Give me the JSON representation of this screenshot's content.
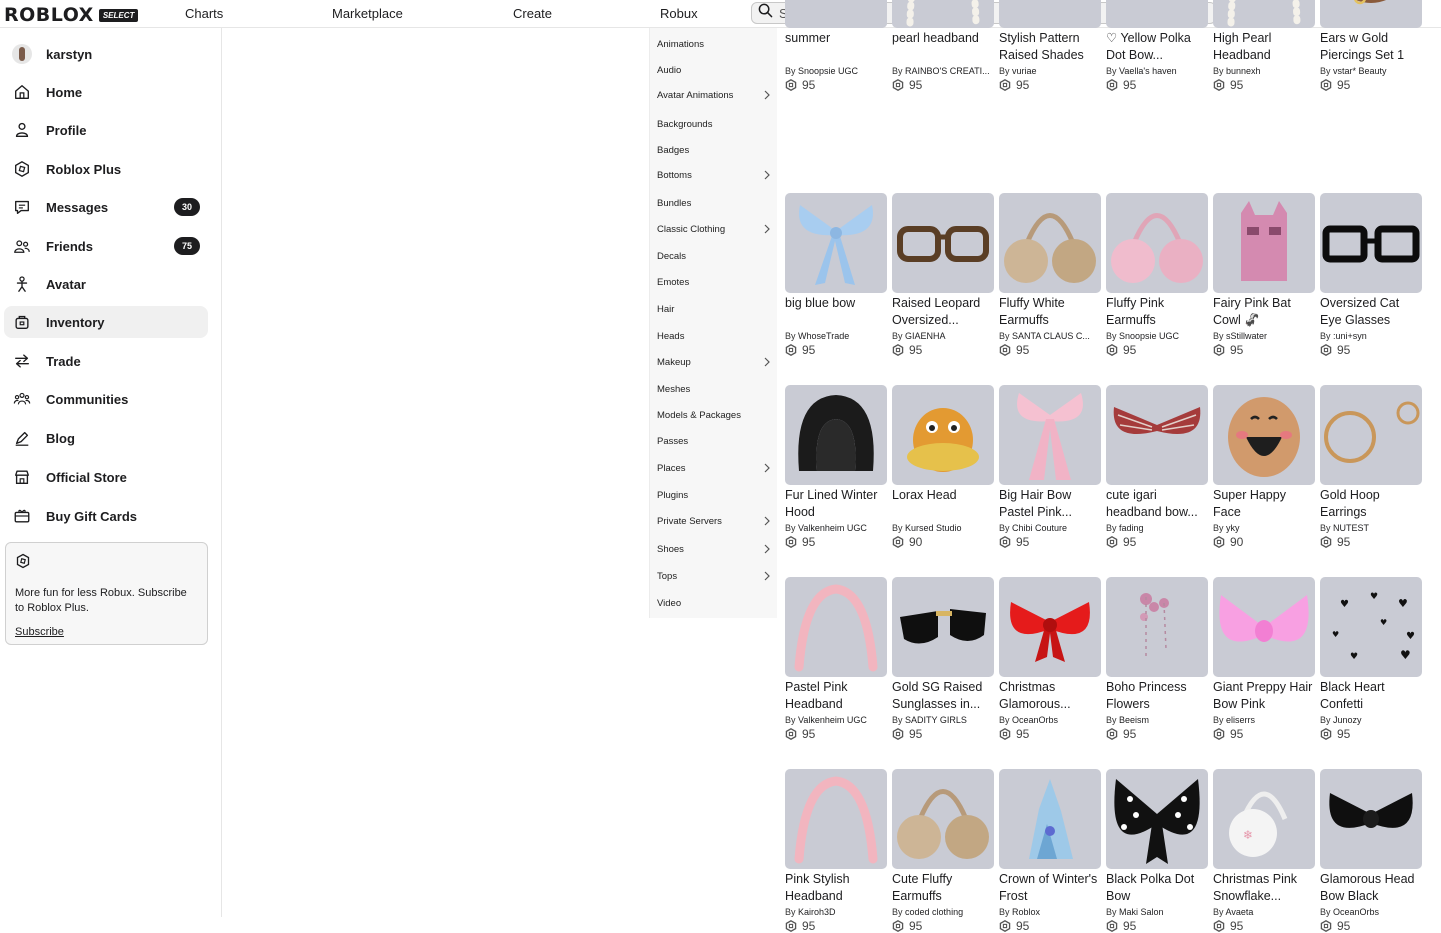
{
  "topbar": {
    "logo": "ROBLOX",
    "logo_badge": "SELECT",
    "nav": [
      "Charts",
      "Marketplace",
      "Create",
      "Robux"
    ],
    "search_placeholder": "Search"
  },
  "sidebar": {
    "user": "karstyn",
    "items": [
      {
        "label": "Home",
        "icon": "home-icon"
      },
      {
        "label": "Profile",
        "icon": "profile-icon"
      },
      {
        "label": "Roblox Plus",
        "icon": "roblox-plus-icon"
      },
      {
        "label": "Messages",
        "icon": "messages-icon",
        "count": "30"
      },
      {
        "label": "Friends",
        "icon": "friends-icon",
        "count": "75"
      },
      {
        "label": "Avatar",
        "icon": "avatar-icon"
      },
      {
        "label": "Inventory",
        "icon": "inventory-icon",
        "active": true
      },
      {
        "label": "Trade",
        "icon": "trade-icon"
      },
      {
        "label": "Communities",
        "icon": "communities-icon"
      },
      {
        "label": "Blog",
        "icon": "blog-icon"
      },
      {
        "label": "Official Store",
        "icon": "store-icon"
      },
      {
        "label": "Buy Gift Cards",
        "icon": "gift-card-icon"
      }
    ],
    "promo": {
      "text": "More fun for less Robux. Subscribe to Roblox Plus.",
      "link": "Subscribe"
    }
  },
  "categories": [
    {
      "label": "Animations",
      "sub": false
    },
    {
      "label": "Audio",
      "sub": false
    },
    {
      "label": "Avatar Animations",
      "sub": true
    },
    {
      "label": "Backgrounds",
      "sub": false
    },
    {
      "label": "Badges",
      "sub": false
    },
    {
      "label": "Bottoms",
      "sub": true
    },
    {
      "label": "Bundles",
      "sub": false
    },
    {
      "label": "Classic Clothing",
      "sub": true
    },
    {
      "label": "Decals",
      "sub": false
    },
    {
      "label": "Emotes",
      "sub": false
    },
    {
      "label": "Hair",
      "sub": false
    },
    {
      "label": "Heads",
      "sub": false
    },
    {
      "label": "Makeup",
      "sub": true
    },
    {
      "label": "Meshes",
      "sub": false
    },
    {
      "label": "Models & Packages",
      "sub": false
    },
    {
      "label": "Passes",
      "sub": false
    },
    {
      "label": "Places",
      "sub": true
    },
    {
      "label": "Plugins",
      "sub": false
    },
    {
      "label": "Private Servers",
      "sub": true
    },
    {
      "label": "Shoes",
      "sub": true
    },
    {
      "label": "Tops",
      "sub": true
    },
    {
      "label": "Video",
      "sub": false
    }
  ],
  "colors": {
    "thumb_bg": "#c9cbd4",
    "accent_dark": "#1d1d1f"
  },
  "items": [
    {
      "name": "summer",
      "creator": "Snoopsie UGC",
      "price": "95",
      "art": "goggles"
    },
    {
      "name": "pearl headband",
      "creator": "RAINBO'S CREATI...",
      "price": "95",
      "art": "pearl"
    },
    {
      "name": "Stylish Pattern Raised Shades",
      "creator": "vuriae",
      "price": "95",
      "art": "shades"
    },
    {
      "name": "♡ Yellow Polka Dot Bow...",
      "creator": "Vaella's haven",
      "price": "95",
      "art": "yellowband"
    },
    {
      "name": "High Pearl Headband",
      "creator": "bunnexh",
      "price": "95",
      "art": "pearl"
    },
    {
      "name": "Ears w Gold Piercings Set 1",
      "creator": "vstar* Beauty",
      "price": "95",
      "art": "ears"
    },
    {
      "name": "big blue bow",
      "creator": "WhoseTrade",
      "price": "95",
      "art": "bluebow"
    },
    {
      "name": "Raised Leopard Oversized...",
      "creator": "GIAENHA",
      "price": "95",
      "art": "leopard"
    },
    {
      "name": "Fluffy White Earmuffs",
      "creator": "SANTA CLAUS C...",
      "price": "95",
      "art": "earmuffbrown"
    },
    {
      "name": "Fluffy Pink Earmuffs",
      "creator": "Snoopsie UGC",
      "price": "95",
      "art": "earmuffpink"
    },
    {
      "name": "Fairy Pink Bat Cowl 🦨",
      "creator": "sStillwater",
      "price": "95",
      "art": "cowl"
    },
    {
      "name": "Oversized Cat Eye Glasses",
      "creator": ":uni+syn",
      "price": "95",
      "art": "glasses"
    },
    {
      "name": "Fur Lined Winter Hood",
      "creator": "Valkenheim UGC",
      "price": "95",
      "art": "hood"
    },
    {
      "name": "Lorax Head",
      "creator": "Kursed Studio",
      "price": "90",
      "art": "lorax"
    },
    {
      "name": "Big Hair Bow Pastel Pink...",
      "creator": "Chibi Couture",
      "price": "95",
      "art": "pinkbow"
    },
    {
      "name": "cute igari headband bow...",
      "creator": "fading",
      "price": "95",
      "art": "plaidbow"
    },
    {
      "name": "Super Happy Face",
      "creator": "yky",
      "price": "90",
      "art": "face"
    },
    {
      "name": "Gold Hoop Earrings",
      "creator": "NUTEST",
      "price": "95",
      "art": "hoops"
    },
    {
      "name": "Pastel Pink Headband",
      "creator": "Valkenheim UGC",
      "price": "95",
      "art": "pinkband"
    },
    {
      "name": "Gold SG Raised Sunglasses in...",
      "creator": "SADITY GIRLS",
      "price": "95",
      "art": "sunglasses"
    },
    {
      "name": "Christmas Glamorous...",
      "creator": "OceanOrbs",
      "price": "95",
      "art": "redbow"
    },
    {
      "name": "Boho Princess Flowers",
      "creator": "Beeism",
      "price": "95",
      "art": "flowers"
    },
    {
      "name": "Giant Preppy Hair Bow Pink",
      "creator": "eliserrs",
      "price": "95",
      "art": "bigpinkbow"
    },
    {
      "name": "Black Heart Confetti",
      "creator": "Junozy",
      "price": "95",
      "art": "hearts"
    },
    {
      "name": "Pink Stylish Headband",
      "creator": "Kairoh3D",
      "price": "95",
      "art": "pinkband"
    },
    {
      "name": "Cute Fluffy Earmuffs",
      "creator": "coded clothing",
      "price": "95",
      "art": "earmuffbrown"
    },
    {
      "name": "Crown of Winter's Frost",
      "creator": "Roblox",
      "price": "95",
      "art": "crown"
    },
    {
      "name": "Black Polka Dot Bow",
      "creator": "Maki Salon",
      "price": "95",
      "art": "polkabow"
    },
    {
      "name": "Christmas Pink Snowflake...",
      "creator": "Avaeta",
      "price": "95",
      "art": "snowmuff"
    },
    {
      "name": "Glamorous Head Bow Black",
      "creator": "OceanOrbs",
      "price": "95",
      "art": "blackbow"
    }
  ],
  "labels": {
    "by": "By"
  }
}
